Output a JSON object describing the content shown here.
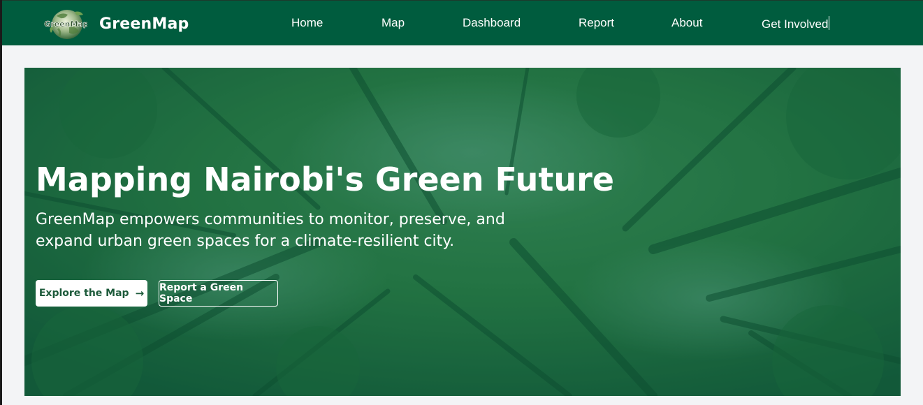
{
  "brand": {
    "name": "GreenMap",
    "logo_text": "GreenMap"
  },
  "nav": {
    "items": [
      {
        "label": "Home"
      },
      {
        "label": "Map"
      },
      {
        "label": "Dashboard"
      },
      {
        "label": "Report"
      },
      {
        "label": "About"
      },
      {
        "label": "Get Involved"
      }
    ]
  },
  "hero": {
    "title": "Mapping Nairobi's Green Future",
    "subtitle": "GreenMap empowers communities to monitor, preserve, and expand urban green spaces for a climate-resilient city.",
    "primary_button": "Explore the Map",
    "primary_button_icon": "arrow-right-icon",
    "secondary_button": "Report a Green Space"
  },
  "colors": {
    "navbar": "#005c3e",
    "hero_overlay": "#1e6b3c",
    "page_background": "#f3f4f6",
    "primary_button_text": "#1c5a3a"
  }
}
